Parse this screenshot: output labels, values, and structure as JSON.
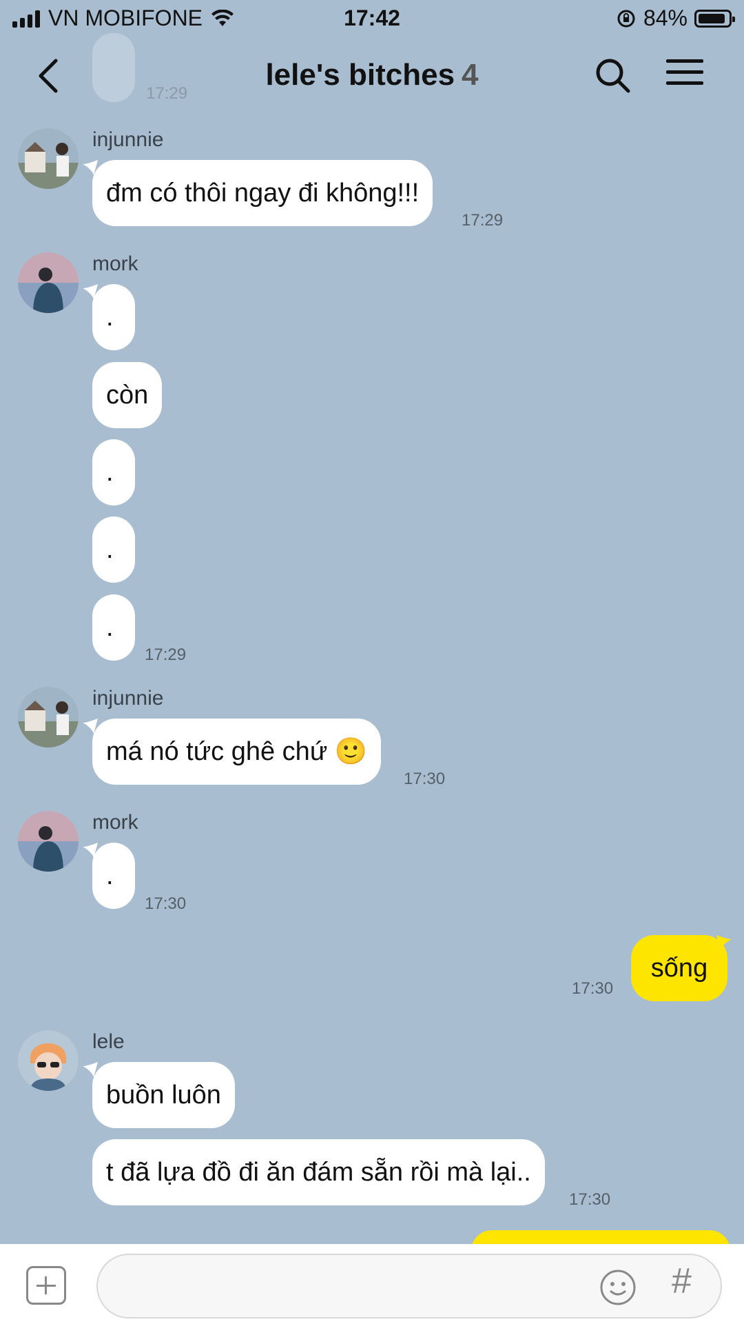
{
  "status_bar": {
    "carrier": "VN MOBIFONE",
    "time": "17:42",
    "battery": "84%"
  },
  "header": {
    "title": "lele's bitches",
    "member_count": "4"
  },
  "ghost_message": {
    "text": ".",
    "time": "17:29"
  },
  "messages": [
    {
      "sender": "injunnie",
      "text": "đm có thôi ngay đi không!!!",
      "time": "17:29"
    },
    {
      "sender": "mork",
      "texts": [
        ".",
        "còn",
        ".",
        ".",
        "."
      ],
      "time": "17:29"
    },
    {
      "sender": "injunnie",
      "text": "má nó tức ghê chứ 🙂",
      "time": "17:30"
    },
    {
      "sender": "mork",
      "text": ".",
      "time": "17:30"
    },
    {
      "sender": "me",
      "text": "sống",
      "time": "17:30"
    },
    {
      "sender": "lele",
      "texts": [
        "buồn luôn",
        "t đã lựa đồ đi ăn đám sẵn rồi mà lại.."
      ],
      "time": "17:30"
    }
  ],
  "input": {
    "placeholder": ""
  },
  "colors": {
    "background": "#a9bdd0",
    "my_bubble": "#fee500",
    "their_bubble": "#ffffff"
  },
  "icons": [
    "back-arrow-icon",
    "search-icon",
    "menu-icon",
    "plus-icon",
    "emoji-icon",
    "hash-icon"
  ]
}
